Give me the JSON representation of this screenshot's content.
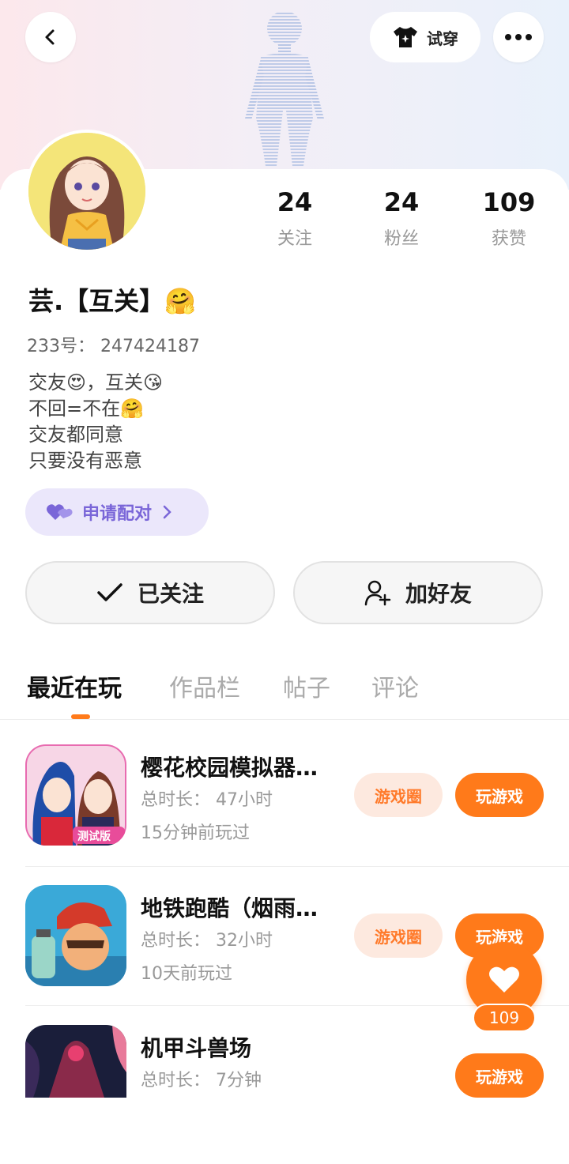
{
  "header": {
    "back_icon": "chevron-left-icon",
    "tryon_label": "试穿",
    "tryon_icon": "tshirt-icon",
    "more_icon": "more-dots-icon"
  },
  "profile": {
    "stats": [
      {
        "value": "24",
        "label": "关注"
      },
      {
        "value": "24",
        "label": "粉丝"
      },
      {
        "value": "109",
        "label": "获赞"
      }
    ],
    "nickname": "芸.【互关】🤗",
    "id_line": "233号： 247424187",
    "bio": "交友😍，互关😘\n不回=不在🤗\n交友都同意\n只要没有恶意",
    "pair_label": "申请配对",
    "follow_label": "已关注",
    "add_friend_label": "加好友"
  },
  "tabs": [
    {
      "label": "最近在玩"
    },
    {
      "label": "作品栏"
    },
    {
      "label": "帖子"
    },
    {
      "label": "评论"
    }
  ],
  "games": [
    {
      "title": "樱花校园模拟器…",
      "duration": "总时长： 47小时",
      "last_played": "15分钟前玩过",
      "circle_label": "游戏圈",
      "play_label": "玩游戏",
      "badge": "测试版"
    },
    {
      "title": "地铁跑酷（烟雨…",
      "duration": "总时长： 32小时",
      "last_played": "10天前玩过",
      "circle_label": "游戏圈",
      "play_label": "玩游戏"
    },
    {
      "title": "机甲斗兽场",
      "duration": "总时长： 7分钟",
      "last_played": "",
      "play_label": "玩游戏"
    }
  ],
  "like_fab": {
    "count": "109"
  },
  "colors": {
    "accent": "#ff7a1a",
    "pair": "#7a66d8"
  }
}
